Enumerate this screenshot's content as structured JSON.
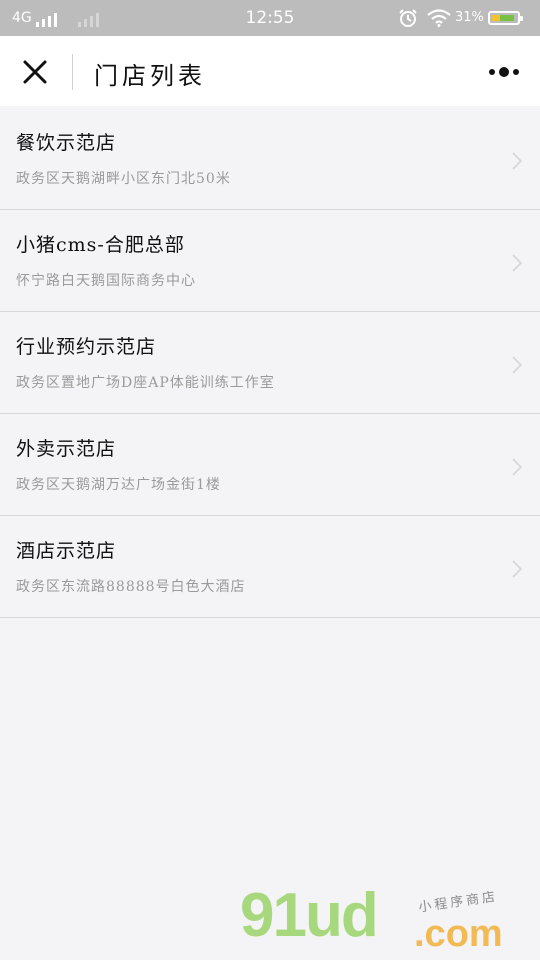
{
  "status_bar": {
    "network": "4G",
    "time": "12:55",
    "battery": "31%"
  },
  "header": {
    "title": "门店列表",
    "close_icon": "close-icon",
    "more_icon": "more-icon"
  },
  "stores": [
    {
      "name": "餐饮示范店",
      "address": "政务区天鹅湖畔小区东门北50米"
    },
    {
      "name": "小猪cms-合肥总部",
      "address": "怀宁路白天鹅国际商务中心"
    },
    {
      "name": "行业预约示范店",
      "address": "政务区置地广场D座AP体能训练工作室"
    },
    {
      "name": "外卖示范店",
      "address": "政务区天鹅湖万达广场金街1楼"
    },
    {
      "name": "酒店示范店",
      "address": "政务区东流路88888号白色大酒店"
    }
  ],
  "watermark": {
    "brand": "91ud",
    "tld": ".com",
    "tagline": "小程序商店"
  }
}
